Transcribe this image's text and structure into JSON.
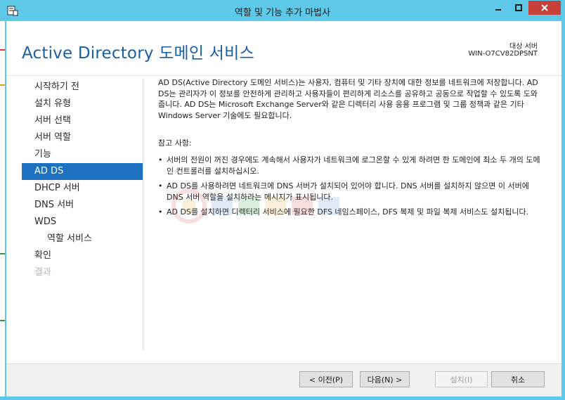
{
  "window": {
    "title": "역할 및 기능 추가 마법사",
    "titlebar_color": "#5ec8e8",
    "close_button_color": "#c7413b"
  },
  "header": {
    "title": "Active Directory 도메인 서비스",
    "destination_label": "대상 서버",
    "destination_server": "WIN-O7CV82DPSNT"
  },
  "nav": {
    "items": [
      {
        "label": "시작하기 전",
        "state": "normal"
      },
      {
        "label": "설치 유형",
        "state": "normal"
      },
      {
        "label": "서버 선택",
        "state": "normal"
      },
      {
        "label": "서버 역할",
        "state": "normal"
      },
      {
        "label": "기능",
        "state": "normal"
      },
      {
        "label": "AD DS",
        "state": "active"
      },
      {
        "label": "DHCP 서버",
        "state": "normal"
      },
      {
        "label": "DNS 서버",
        "state": "normal"
      },
      {
        "label": "WDS",
        "state": "normal"
      },
      {
        "label": "역할 서비스",
        "state": "sub"
      },
      {
        "label": "확인",
        "state": "normal"
      },
      {
        "label": "결과",
        "state": "disabled"
      }
    ],
    "active_color": "#1e70c0"
  },
  "content": {
    "intro": "AD DS(Active Directory 도메인 서비스)는 사용자, 컴퓨터 및 기타 장치에 대한 정보를 네트워크에 저장합니다. AD DS는 관리자가 이 정보를 안전하게 관리하고 사용자들이 편리하게 리소스를 공유하고 공동으로 작업할 수 있도록 도와줍니다. AD DS는 Microsoft Exchange Server와 같은 디렉터리 사용 응용 프로그램 및 그룹 정책과 같은 기타 Windows Server 기술에도 필요합니다.",
    "notes_heading": "참고 사항:",
    "notes": [
      "서버의 전원이 꺼진 경우에도 계속해서 사용자가 네트워크에 로그온할 수 있게 하려면 한 도메인에 최소 두 개의 도메인 컨트롤러를 설치하십시오.",
      "AD DS를 사용하려면 네트워크에 DNS 서버가 설치되어 있어야 합니다. DNS 서버를 설치하지 않으면 이 서버에 DNS 서버 역할을 설치하라는 메시지가 표시됩니다.",
      "AD DS를 설치하면 디렉터리 서비스에 필요한 DFS 네임스페이스, DFS 복제 및 파일 복제 서비스도 설치됩니다."
    ]
  },
  "footer": {
    "prev_label": "< 이전(P)",
    "next_label": "다음(N) >",
    "install_label": "설치(I)",
    "cancel_label": "취소"
  }
}
